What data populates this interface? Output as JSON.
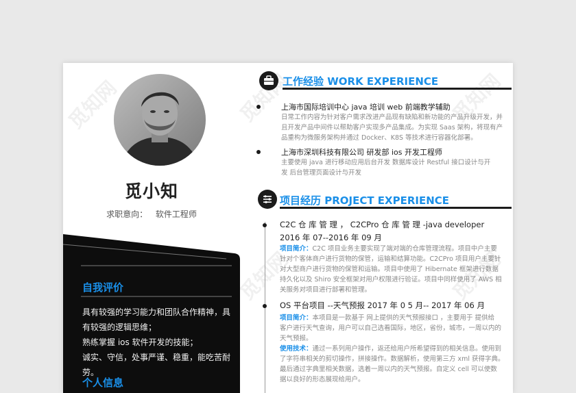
{
  "watermark": "觅知网",
  "profile": {
    "name": "觅小知",
    "intent_label": "求职意向：",
    "intent_value": "软件工程师"
  },
  "self_eval": {
    "title": "自我评价",
    "lines": [
      "具有较强的学习能力和团队合作精神，具",
      "有较强的逻辑思维；",
      "熟练掌握 ios 软件开发的技能；",
      "诚实、守信，处事严谨、稳重，能吃苦耐",
      "劳。"
    ]
  },
  "personal_info": {
    "title": "个人信息"
  },
  "work": {
    "title": "工作经验  WORK EXPERIENCE",
    "items": [
      {
        "head": "上海市国际培训中心  java  培训           web  前端教学辅助",
        "desc": [
          "日常工作内容为针对客户需求改进产品现有缺陷和新功能的产品升级开发，并",
          "且开发产品中间件以帮助客户实现多产品集成。为实现 Saas 架构，将现有产",
          "品重构为微服务架构并通过 Docker、K8S 等技术进行容器化部署。"
        ]
      },
      {
        "head": "上海市深圳科技有限公司              研发部  ios  开发工程师",
        "desc": [
          "主要使用 java 进行移动应用后台开发  数据库设计  Restful 接口设计与开",
          "发  后台管理页面设计与开发"
        ]
      }
    ]
  },
  "project": {
    "title": "项目经历  PROJECT EXPERIENCE",
    "items": [
      {
        "head": "C2C  仓 库 管 理 ，  C2CPro  仓 库 管 理 -java  developer",
        "date": "2016 年 07--2016 年 09 月",
        "label": "项目简介：",
        "desc": [
          "C2C  项目业务主要实现了端对端的仓库管理流程。项目中户主要",
          "针对个客体商户进行货物的保管，运输和结算功能。C2CPro 项目用户主要针",
          "对大型商户进行货物的保管和运输。项目中使用了 Hibernate 框架进行数据",
          "持久化以及 Shiro 安全框架对用户权限进行验证。项目中同样使用了 AWS 相",
          "关服务对项目进行部署和管理。"
        ]
      },
      {
        "head": "OS 平台项目  --天气预报      2017  年  0 5  月-- 2017  年  06  月",
        "label": "项目简介：",
        "desc": [
          "本项目是一款基于  网上提供的天气预报接口 ，主要用于  提供给",
          "客户进行天气查询，用户可以自己选看国际，地区，省份，城市，一周以内的",
          "天气预报。"
        ],
        "label2": "使用技术：",
        "desc2": [
          "通过一系列用户操作，返还给用户所希望得到的相关信息。使用到",
          "了字符串相关的剪切操作，拼接操作。数据解析，使用第三方 xml 获得字典。",
          "最后通过字典里相关数据，选着一周以内的天气预报。自定义 cell 可以使数",
          "据以良好的形态展现给用户。"
        ]
      }
    ]
  },
  "colors": {
    "accent": "#1a8fe8",
    "dark": "#111111"
  },
  "icons": [
    "briefcase-icon",
    "list-icon"
  ]
}
